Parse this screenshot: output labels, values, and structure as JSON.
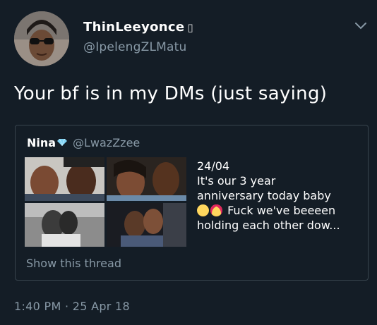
{
  "tweet": {
    "display_name": "ThinLeeyonce",
    "name_badge": "▯",
    "handle": "@IpelengZLMatu",
    "text": "Your bf is in my DMs (just saying)",
    "timestamp": "1:40 PM · 25 Apr 18"
  },
  "quoted": {
    "display_name": "Nina",
    "handle": "@LwazZzee",
    "lines": [
      "24/04",
      "It's our 3 year",
      "anniversary today baby",
      "Fuck we've beeeen",
      "holding each other dow..."
    ],
    "show_thread": "Show this thread",
    "emojis": [
      "pleading-face",
      "heart-eyes-face"
    ]
  },
  "icons": {
    "chevron": "chevron-down-icon",
    "verified": "diamond-verified-icon"
  },
  "colors": {
    "background": "#141d26",
    "secondary_text": "#8899a6",
    "border": "#38444d",
    "verified": "#1da1f2"
  }
}
